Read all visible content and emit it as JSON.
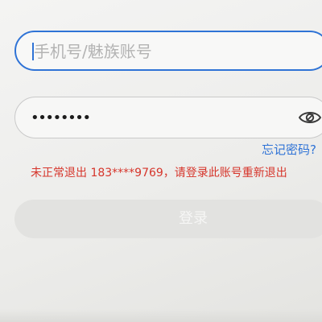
{
  "account": {
    "placeholder": "手机号/魅族账号",
    "focused": true
  },
  "password": {
    "masked_value": "••••••••",
    "visibility_icon": "eye-icon"
  },
  "forgot_password": {
    "label": "忘记密码?"
  },
  "warning": {
    "text": "未正常退出 183****9769，请登录此账号重新退出"
  },
  "login_button": {
    "label": "登录",
    "enabled": false
  },
  "colors": {
    "accent": "#2f73d6",
    "warning": "#d6352b",
    "placeholder": "#b3b3b3",
    "disabled_button": "#e2e2e0"
  }
}
